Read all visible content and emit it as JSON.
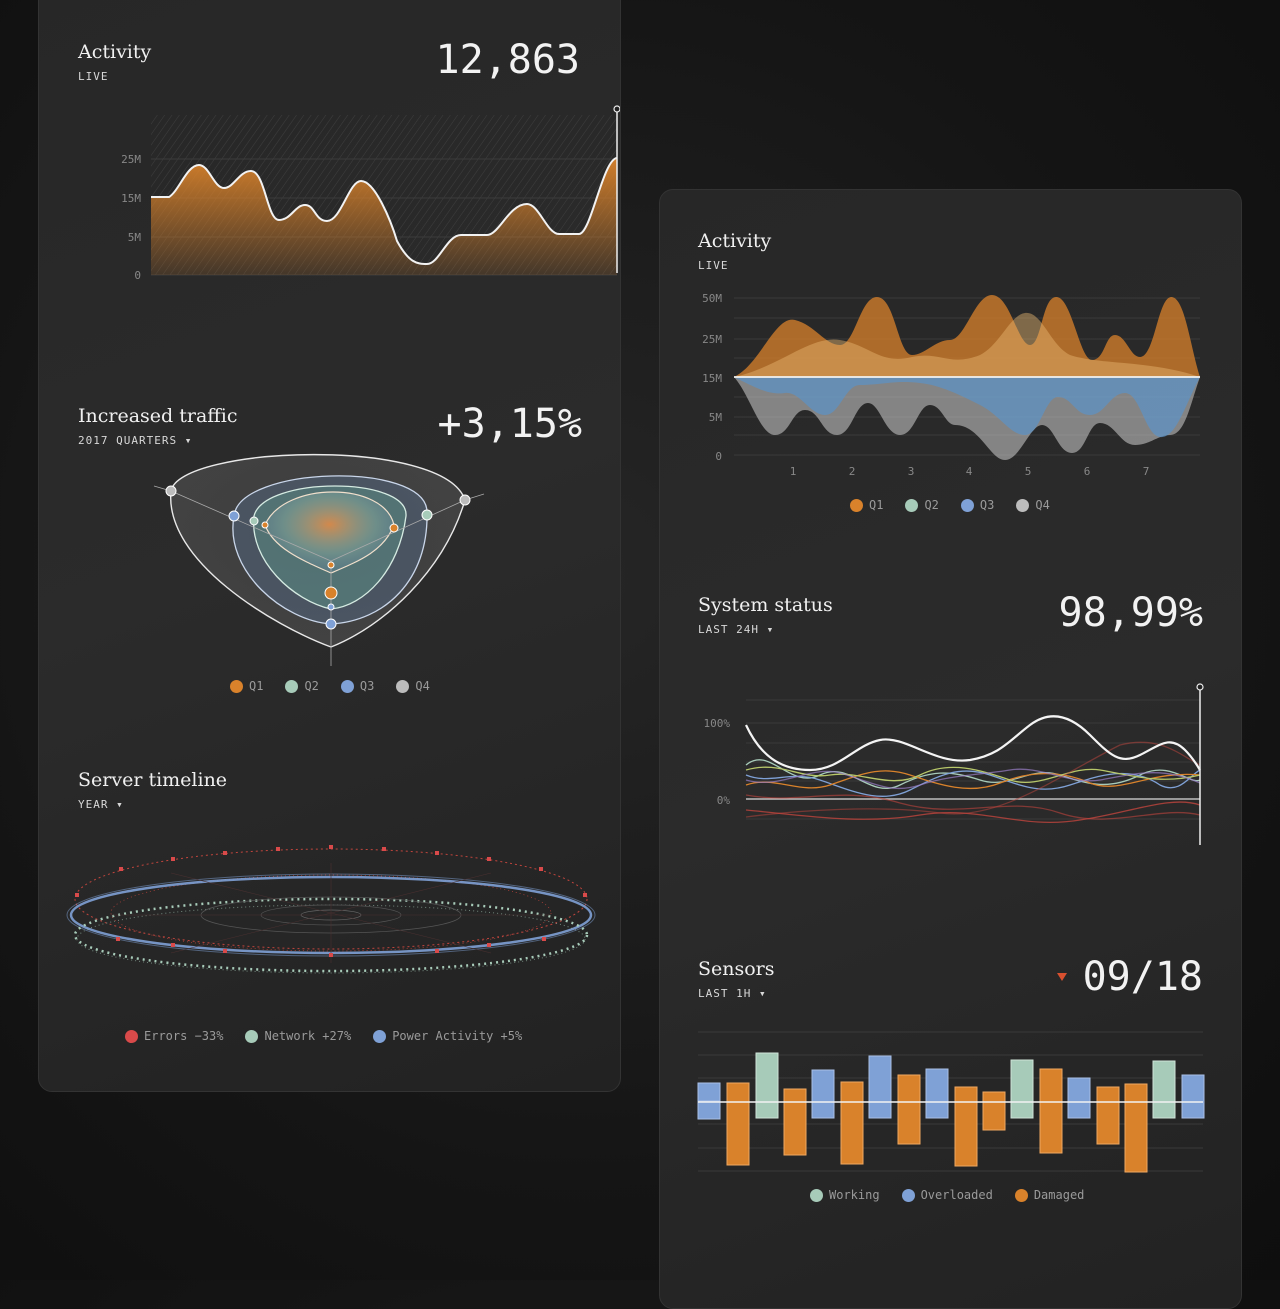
{
  "colors": {
    "orange": "#d9822b",
    "green": "#a7cbb9",
    "blue": "#7fa1d6",
    "grey": "#bcbcbc",
    "red": "#d94a4a",
    "background": "#141414",
    "panel": "#282828"
  },
  "left": {
    "activity": {
      "title": "Activity",
      "subtitle": "LIVE",
      "value": "12,863",
      "yticks": [
        "25M",
        "15M",
        "5M",
        "0"
      ]
    },
    "traffic": {
      "title": "Increased traffic",
      "subtitle": "2017 QUARTERS",
      "value": "+3,15%",
      "legend": [
        {
          "label": "Q1",
          "color": "#d9822b"
        },
        {
          "label": "Q2",
          "color": "#a7cbb9"
        },
        {
          "label": "Q3",
          "color": "#7fa1d6"
        },
        {
          "label": "Q4",
          "color": "#bcbcbc"
        }
      ]
    },
    "timeline": {
      "title": "Server timeline",
      "subtitle": "YEAR",
      "legend": [
        {
          "label": "Errors −33%",
          "color": "#d94a4a"
        },
        {
          "label": "Network +27%",
          "color": "#a7cbb9"
        },
        {
          "label": "Power Activity +5%",
          "color": "#7fa1d6"
        }
      ]
    }
  },
  "right": {
    "activity": {
      "title": "Activity",
      "subtitle": "LIVE",
      "yticks": [
        "50M",
        "25M",
        "15M",
        "5M",
        "0"
      ],
      "xticks": [
        "1",
        "2",
        "3",
        "4",
        "5",
        "6",
        "7"
      ],
      "legend": [
        {
          "label": "Q1",
          "color": "#d9822b"
        },
        {
          "label": "Q2",
          "color": "#a7cbb9"
        },
        {
          "label": "Q3",
          "color": "#7fa1d6"
        },
        {
          "label": "Q4",
          "color": "#bcbcbc"
        }
      ]
    },
    "status": {
      "title": "System status",
      "subtitle": "LAST 24H",
      "value": "98,99%",
      "yticks": [
        "100%",
        "0%"
      ]
    },
    "sensors": {
      "title": "Sensors",
      "subtitle": "LAST 1H",
      "value": "09/18",
      "trend_icon": "down-triangle-icon",
      "legend": [
        {
          "label": "Working",
          "color": "#a7cbb9"
        },
        {
          "label": "Overloaded",
          "color": "#7fa1d6"
        },
        {
          "label": "Damaged",
          "color": "#d9822b"
        }
      ]
    }
  }
}
